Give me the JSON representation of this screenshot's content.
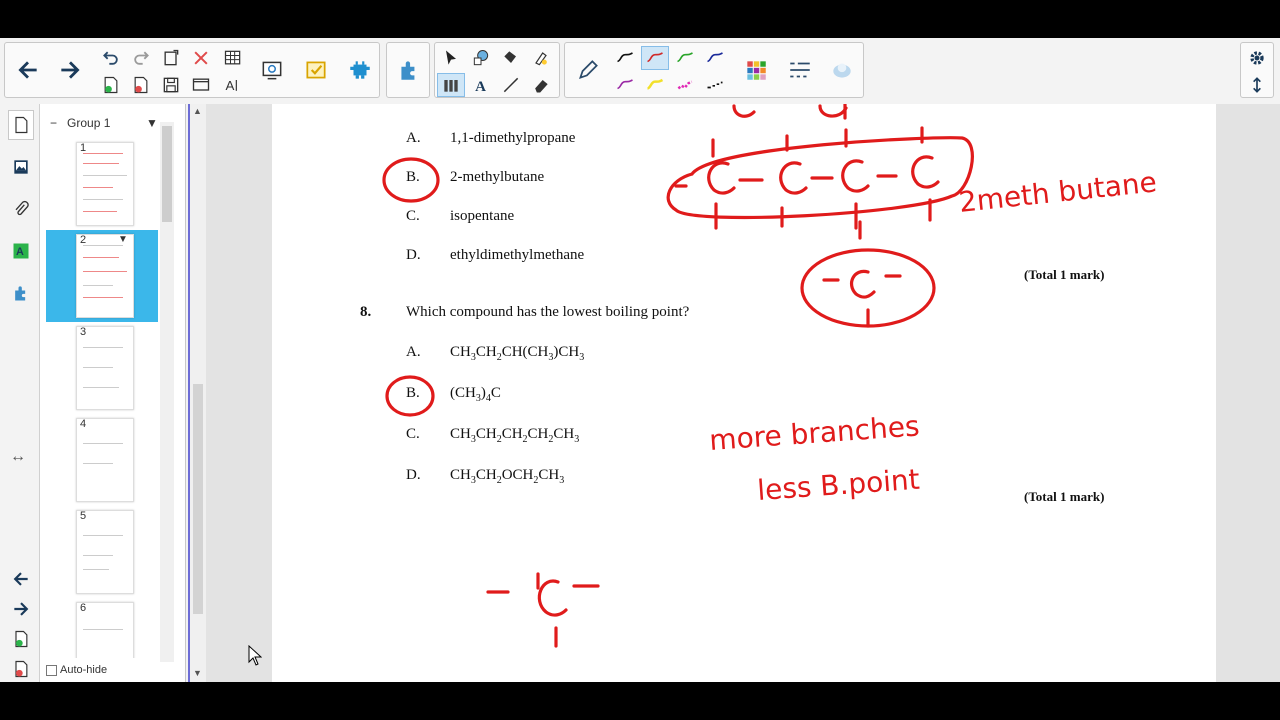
{
  "toolbar": {
    "icons": [
      "back-arrow",
      "forward-arrow",
      "undo",
      "redo",
      "paste",
      "delete",
      "table",
      "add-page",
      "delete-page",
      "save",
      "fullscreen",
      "text-style",
      "screen-capture",
      "response-check",
      "activity-builder",
      "add-ons",
      "select",
      "shape",
      "fill",
      "eraser-shape",
      "pen-color-styles",
      "text",
      "line",
      "eraser",
      "pen",
      "color-palette",
      "line-style",
      "object-fill",
      "settings",
      "expand"
    ]
  },
  "sidebar": {
    "group_label": "Group 1",
    "pages": [
      {
        "num": "1"
      },
      {
        "num": "2"
      },
      {
        "num": "3"
      },
      {
        "num": "4"
      },
      {
        "num": "5"
      },
      {
        "num": "6"
      }
    ],
    "autohide_label": "Auto-hide"
  },
  "page": {
    "q7": {
      "A": {
        "letter": "A.",
        "text": "1,1-dimethylpropane"
      },
      "B": {
        "letter": "B.",
        "text": "2-methylbutane"
      },
      "C": {
        "letter": "C.",
        "text": "isopentane"
      },
      "D": {
        "letter": "D.",
        "text": "ethyldimethylmethane"
      },
      "total": "(Total 1 mark)"
    },
    "q8": {
      "number": "8.",
      "question": "Which compound has the lowest boiling point?",
      "A_letter": "A.",
      "B_letter": "B.",
      "C_letter": "C.",
      "D_letter": "D.",
      "total": "(Total 1 mark)"
    }
  },
  "ink": {
    "color": "#e01b1b",
    "annotation_1": "2meth butane",
    "annotation_2_line1": "more branches",
    "annotation_2_line2": "less B.point"
  }
}
